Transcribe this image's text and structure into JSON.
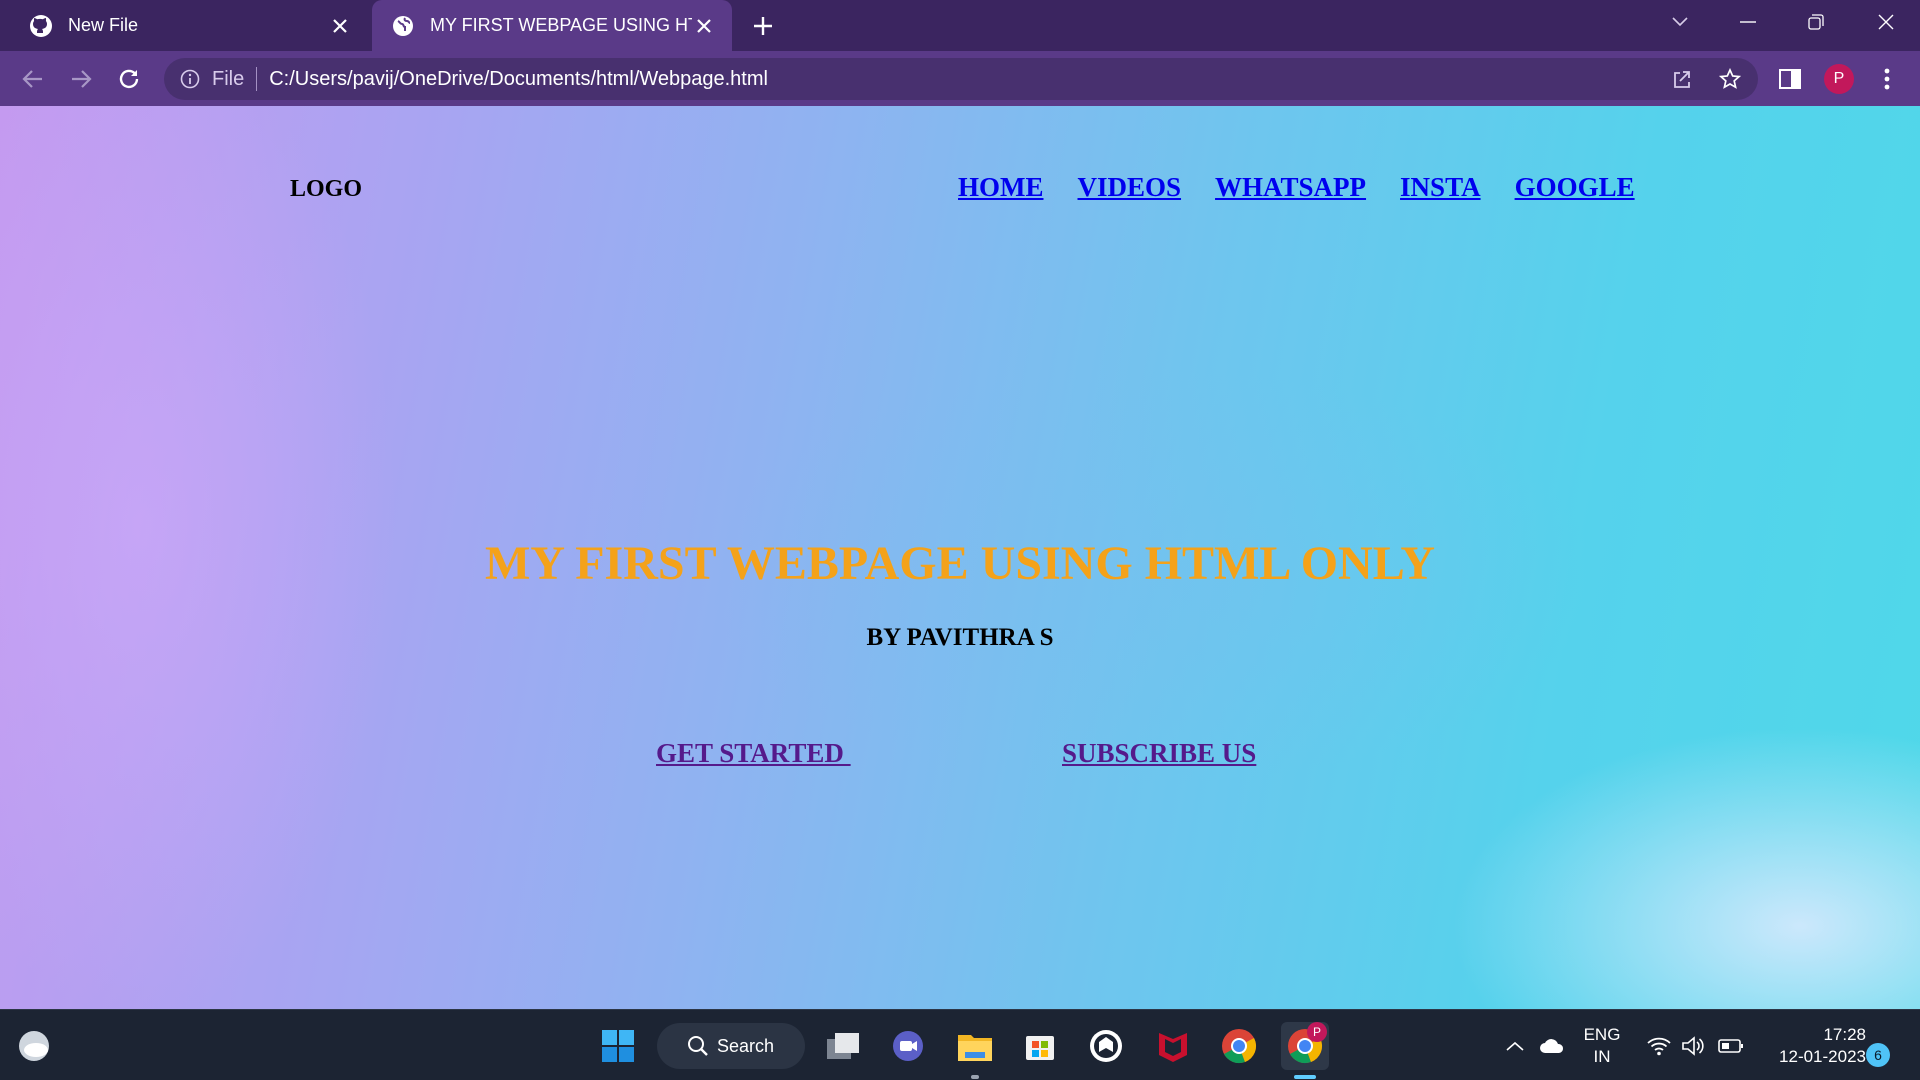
{
  "browser": {
    "tabs": [
      {
        "title": "New File",
        "icon": "github-icon"
      },
      {
        "title": "MY FIRST WEBPAGE USING HTML",
        "icon": "globe-icon"
      }
    ],
    "new_tab_icon": "plus-icon",
    "window_controls": [
      "chevron-down-icon",
      "minimize-icon",
      "restore-icon",
      "close-icon"
    ],
    "address": {
      "scheme_label": "File",
      "url": "C:/Users/pavij/OneDrive/Documents/html/Webpage.html"
    },
    "profile_initial": "P"
  },
  "page": {
    "logo": "LOGO",
    "nav": [
      "HOME",
      "VIDEOS",
      "WHATSAPP",
      "INSTA",
      "GOOGLE"
    ],
    "title": "MY FIRST WEBPAGE USING HTML ONLY",
    "subtitle": "BY PAVITHRA S",
    "get_started": "GET STARTED ",
    "subscribe": "SUBSCRIBE US",
    "colors": {
      "title": "#f4a21a",
      "nav_link": "#0000ee",
      "visited_link": "#551a8b"
    }
  },
  "taskbar": {
    "search_label": "Search",
    "apps": [
      "start-icon",
      "search",
      "task-view-icon",
      "chat-icon",
      "file-explorer-icon",
      "store-icon",
      "dell-icon",
      "mcafee-icon",
      "chrome-icon",
      "chrome-profile-icon"
    ],
    "chrome_badge": "P",
    "lang_line1": "ENG",
    "lang_line2": "IN",
    "time": "17:28",
    "date": "12-01-2023",
    "notification_count": "6"
  }
}
